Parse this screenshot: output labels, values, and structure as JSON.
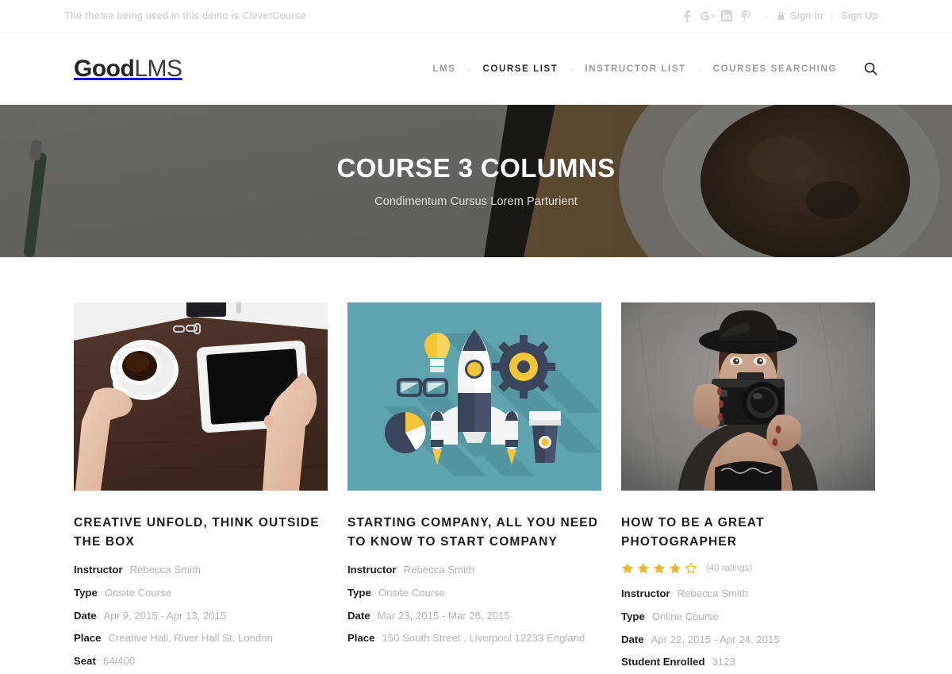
{
  "topbar": {
    "note": "The theme being used in this demo is CleverCourse",
    "social": [
      {
        "name": "facebook-icon",
        "label": "f"
      },
      {
        "name": "googleplus-icon",
        "label": "g+"
      },
      {
        "name": "linkedin-icon",
        "label": "in"
      },
      {
        "name": "pinterest-icon",
        "label": "P"
      }
    ],
    "separator_dot": "·",
    "lock_icon": "lock-icon",
    "sign_in": "Sign In",
    "pipe": "|",
    "sign_up": "Sign Up"
  },
  "header": {
    "logo_strong": "Good",
    "logo_light": "LMS",
    "nav": [
      {
        "label": "LMS",
        "active": false
      },
      {
        "label": "COURSE LIST",
        "active": true
      },
      {
        "label": "INSTRUCTOR LIST",
        "active": false
      },
      {
        "label": "COURSES SEARCHING",
        "active": false
      }
    ],
    "nav_dot": "·",
    "search_icon": "search-icon"
  },
  "hero": {
    "title": "COURSE 3 COLUMNS",
    "subtitle": "Condimentum Cursus Lorem Parturient"
  },
  "colors": {
    "accent_star": "#ecb731",
    "text_dark": "#1e1e1e",
    "text_muted": "#b6b6b6",
    "nav_muted": "#9b9b9b",
    "topbar_muted": "#c9c9c9",
    "card2_bg": "#5fa3ae"
  },
  "courses": [
    {
      "title": "CREATIVE UNFOLD, THINK OUTSIDE THE BOX",
      "thumb": "desk-coffee-tablet-photo",
      "rating": null,
      "meta": [
        {
          "label": "Instructor",
          "value": "Rebecca Smith"
        },
        {
          "label": "Type",
          "value": "Onsite Course"
        },
        {
          "label": "Date",
          "value": "Apr 9, 2015 - Apr 13, 2015"
        },
        {
          "label": "Place",
          "value": "Creative Hall, River Hall St. London"
        },
        {
          "label": "Seat",
          "value": "64/400"
        }
      ]
    },
    {
      "title": "STARTING COMPANY, ALL YOU NEED TO KNOW TO START COMPANY",
      "thumb": "flat-rocket-startup-illustration",
      "rating": null,
      "meta": [
        {
          "label": "Instructor",
          "value": "Rebecca Smith"
        },
        {
          "label": "Type",
          "value": "Onsite Course"
        },
        {
          "label": "Date",
          "value": "Mar 23, 2015 - Mar 26, 2015"
        },
        {
          "label": "Place",
          "value": "150 South Street , Liverpool 12233 England"
        }
      ]
    },
    {
      "title": "HOW TO BE A GREAT PHOTOGRAPHER",
      "thumb": "woman-with-camera-photo",
      "rating": {
        "filled": 4,
        "total": 5,
        "count_label": "(40 ratings)"
      },
      "meta": [
        {
          "label": "Instructor",
          "value": "Rebecca Smith"
        },
        {
          "label": "Type",
          "value": "Online Course"
        },
        {
          "label": "Date",
          "value": "Apr 22, 2015 - Apr 24, 2015"
        },
        {
          "label": "Student Enrolled",
          "value": "3123"
        }
      ]
    }
  ]
}
